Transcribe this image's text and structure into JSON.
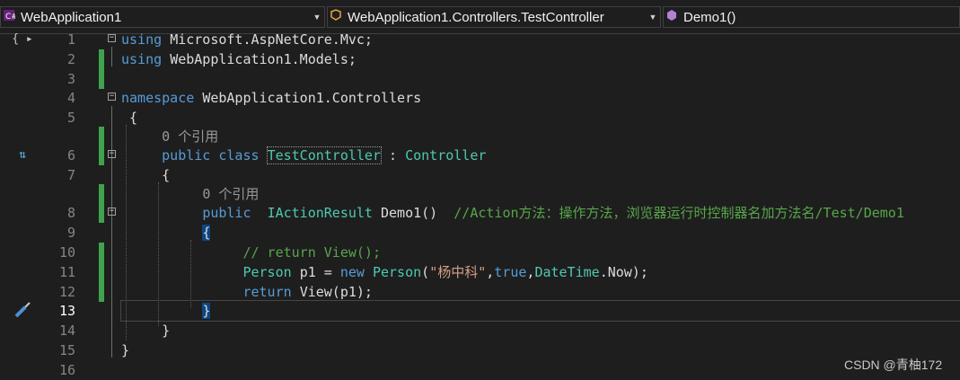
{
  "navbar": {
    "project": "WebApplication1",
    "class": "WebApplication1.Controllers.TestController",
    "member": "Demo1()"
  },
  "editor": {
    "lines": [
      {
        "n": "1"
      },
      {
        "n": "2"
      },
      {
        "n": "3"
      },
      {
        "n": "4"
      },
      {
        "n": "5"
      },
      {
        "n": "6"
      },
      {
        "n": "7"
      },
      {
        "n": "8"
      },
      {
        "n": "9"
      },
      {
        "n": "10"
      },
      {
        "n": "11"
      },
      {
        "n": "12"
      },
      {
        "n": "13"
      },
      {
        "n": "14"
      },
      {
        "n": "15"
      },
      {
        "n": "16"
      }
    ],
    "codelens": [
      "0 个引用",
      "0 个引用"
    ],
    "tokens": {
      "using": "using",
      "ns_mvc": "Microsoft.AspNetCore.Mvc;",
      "ns_models": "WebApplication1.Models;",
      "namespace": "namespace",
      "ns_controllers": "WebApplication1.Controllers",
      "open_brace": "{",
      "close_brace": "}",
      "public": "public",
      "class": "class",
      "class_name": "TestController",
      "colon": ":",
      "base_class": "Controller",
      "return_type": "IActionResult",
      "method": "Demo1()",
      "method_comment": "//Action方法：操作方法，浏览器运行时控制器名加方法名/Test/Demo1",
      "comment_return": "// return View();",
      "person": "Person",
      "var": "p1",
      "assign": "=",
      "new": "new",
      "person_ctor": "Person",
      "paren_open": "(",
      "str_val": "\"杨中科\"",
      "comma1": ",",
      "true_kw": "true",
      "comma2": ",",
      "datetime": "DateTime",
      "now": ".Now);",
      "return_kw": "return",
      "view_call": "View(p1);"
    }
  },
  "glyphs": {
    "top_left": "{ ▸",
    "line6": "⇅",
    "line13": "🖌"
  },
  "watermark": "CSDN @青柚172",
  "colors": {
    "keyword": "#569cd6",
    "type": "#4ec9b0",
    "string": "#d69d85",
    "comment": "#57a64a",
    "change_bar": "#3fa34d"
  }
}
